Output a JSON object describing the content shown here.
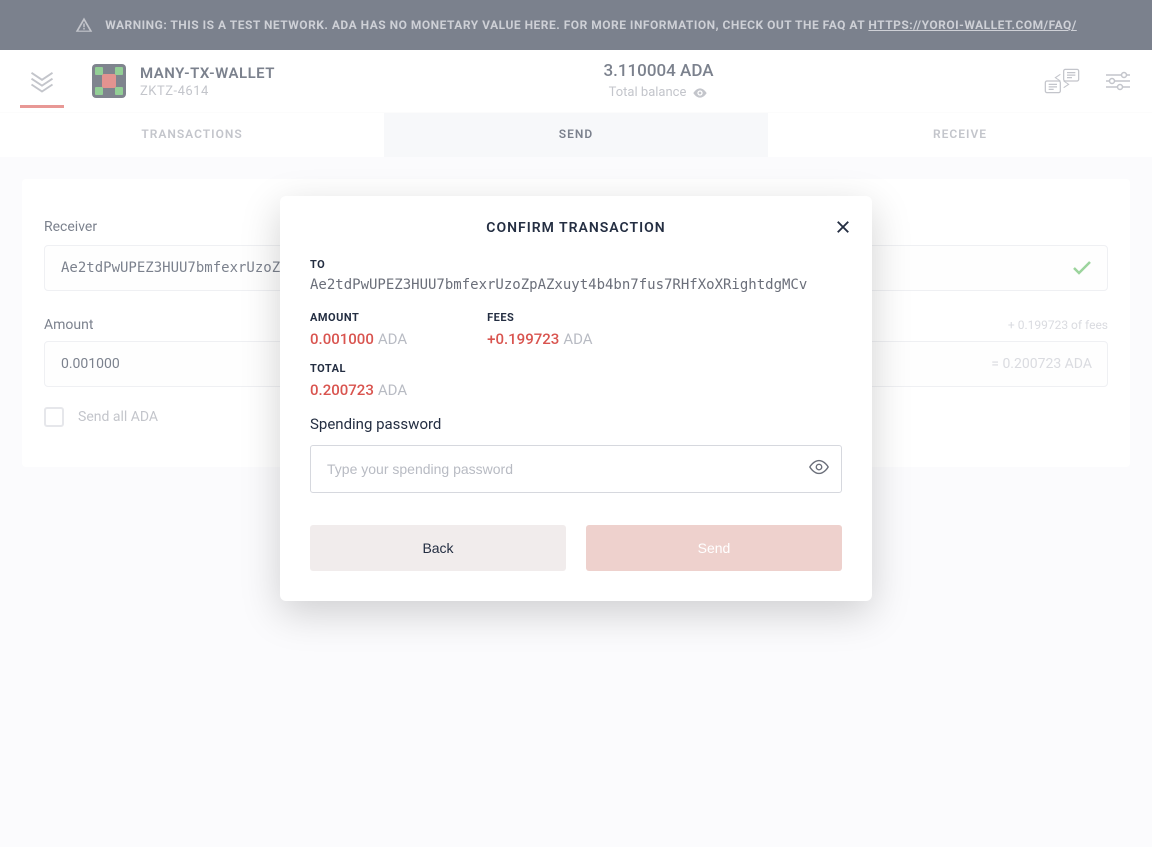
{
  "warning": {
    "prefix": "WARNING: THIS IS A TEST NETWORK. ADA HAS NO MONETARY VALUE HERE. FOR MORE INFORMATION, CHECK OUT THE FAQ AT ",
    "link": "HTTPS://YOROI-WALLET.COM/FAQ/"
  },
  "wallet": {
    "name": "MANY-TX-WALLET",
    "sub": "ZKTZ-4614"
  },
  "balance": {
    "amount": "3.110004 ADA",
    "label": "Total balance"
  },
  "tabs": {
    "transactions": "TRANSACTIONS",
    "send": "SEND",
    "receive": "RECEIVE"
  },
  "form": {
    "receiver_label": "Receiver",
    "receiver_value": "Ae2tdPwUPEZ3HUU7bmfexrUzoZpAZxuyt4b4bn7fus7RHfXoXRightdgMCv",
    "amount_label": "Amount",
    "fees_hint": "+ 0.199723 of fees",
    "amount_value": "0.001000",
    "eq_value": "= 0.200723 ADA",
    "sendall_label": "Send all ADA"
  },
  "modal": {
    "title": "CONFIRM TRANSACTION",
    "to_label": "TO",
    "to_value": "Ae2tdPwUPEZ3HUU7bmfexrUzoZpAZxuyt4b4bn7fus7RHfXoXRightdgMCv",
    "amount_label": "AMOUNT",
    "amount_num": "0.001000",
    "amount_cur": "ADA",
    "fees_label": "FEES",
    "fees_num": "+0.199723",
    "fees_cur": "ADA",
    "total_label": "TOTAL",
    "total_num": "0.200723",
    "total_cur": "ADA",
    "pw_label": "Spending password",
    "pw_placeholder": "Type your spending password",
    "back": "Back",
    "send": "Send"
  }
}
